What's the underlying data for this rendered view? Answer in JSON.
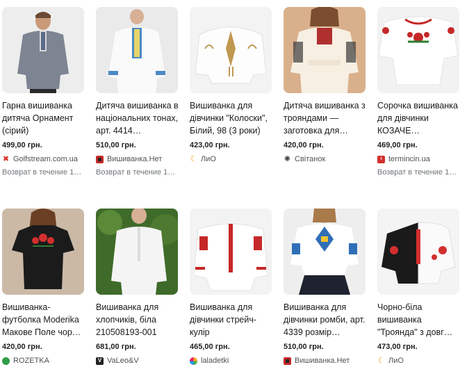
{
  "products": [
    {
      "title": "Гарна вишиванка дитяча Орнамент (сірий)",
      "price": "499,00 грн.",
      "source": "Golfstream.com.ua",
      "source_icon": "red-cross-icon",
      "return": "Возврат в течение 1…"
    },
    {
      "title": "Дитяча вишиванка в національних тонах, арт. 4414…",
      "price": "510,00 грн.",
      "source": "Вишиванка.Нет",
      "source_icon": "embroidery-pattern-icon",
      "return": "Возврат в течение 1…"
    },
    {
      "title": "Вишиванка для дівчинки \"Колоски\", Білий, 98 (3 роки)",
      "price": "423,00 грн.",
      "source": "ЛиО",
      "source_icon": "orange-swirl-icon"
    },
    {
      "title": "Дитяча вишиванка з трояндами — заготовка для…",
      "price": "420,00 грн.",
      "source": "Світанок",
      "source_icon": "sun-icon"
    },
    {
      "title": "Сорочка вишиванка для дівчинки КОЗАЧЕ…",
      "price": "469,00 грн.",
      "source": "termincin.ua",
      "source_icon": "red-badge-icon",
      "return": "Возврат в течение 1…"
    },
    {
      "title": "Вишиванка-футболка Moderika Макове Поле чор…",
      "price": "420,00 грн.",
      "source": "ROZETKA",
      "source_icon": "green-circle-icon"
    },
    {
      "title": "Вишиванка для хлопчиків, біла 210508193-001",
      "price": "681,00 грн.",
      "source": "VaLeo&V",
      "source_icon": "v-letter-icon"
    },
    {
      "title": "Вишиванка для дівчинки стрейч-кулір",
      "price": "465,00 грн.",
      "source": "laladetki",
      "source_icon": "colorful-dots-icon"
    },
    {
      "title": "Вишиванка для дівчинки ромби, арт. 4339 розмір…",
      "price": "510,00 грн.",
      "source": "Вишиванка.Нет",
      "source_icon": "embroidery-pattern-icon"
    },
    {
      "title": "Чорно-біла вишиванка \"Троянда\" з довг…",
      "price": "473,00 грн.",
      "source": "ЛиО",
      "source_icon": "orange-swirl-icon"
    }
  ],
  "colors": {
    "price_text": "#202124",
    "secondary_text": "#70757a",
    "thumb_bg": "#f1f1f1"
  }
}
